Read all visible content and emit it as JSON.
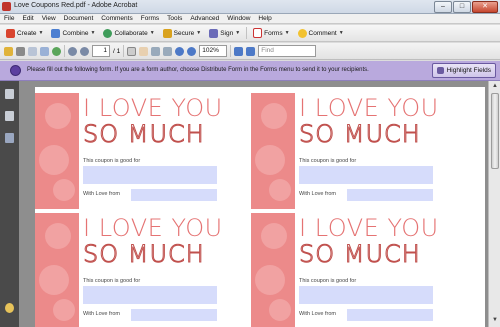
{
  "window": {
    "title": "Love Coupons Red.pdf - Adobe Acrobat",
    "min": "–",
    "max": "□",
    "close": "✕"
  },
  "menu": [
    "File",
    "Edit",
    "View",
    "Document",
    "Comments",
    "Forms",
    "Tools",
    "Advanced",
    "Window",
    "Help"
  ],
  "toolbar1": {
    "create": "Create",
    "combine": "Combine",
    "collaborate": "Collaborate",
    "secure": "Secure",
    "sign": "Sign",
    "forms": "Forms",
    "comment": "Comment"
  },
  "toolbar2": {
    "page_current": "1",
    "page_total": "/ 1",
    "zoom": "102%",
    "find_placeholder": "Find"
  },
  "notice": {
    "message": "Please fill out the following form. If you are a form author, choose Distribute Form in the Forms menu to send it to your recipients.",
    "highlight_button": "Highlight Fields"
  },
  "coupons": [
    {
      "line1": "I LOVE YOU",
      "line2": "SO MUCH",
      "good_for_label": "This coupon is good for",
      "from_label": "With Love from",
      "good_for_value": "",
      "from_value": ""
    },
    {
      "line1": "I LOVE YOU",
      "line2": "SO MUCH",
      "good_for_label": "This coupon is good for",
      "from_label": "With Love from",
      "good_for_value": "",
      "from_value": ""
    },
    {
      "line1": "I LOVE YOU",
      "line2": "SO MUCH",
      "good_for_label": "This coupon is good for",
      "from_label": "With Love from",
      "good_for_value": "",
      "from_value": ""
    },
    {
      "line1": "I LOVE YOU",
      "line2": "SO MUCH",
      "good_for_label": "This coupon is good for",
      "from_label": "With Love from",
      "good_for_value": "",
      "from_value": ""
    }
  ],
  "colors": {
    "accent_pink": "#ec8a8a",
    "field_blue": "#d6dcfb",
    "notice_purple": "#b9a9dd"
  }
}
